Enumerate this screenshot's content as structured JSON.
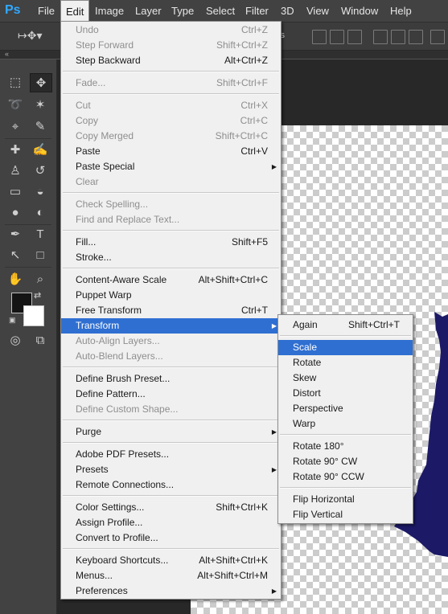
{
  "app": {
    "logo": "Ps"
  },
  "menubar": [
    "File",
    "Edit",
    "Image",
    "Layer",
    "Type",
    "Select",
    "Filter",
    "3D",
    "View",
    "Window",
    "Help"
  ],
  "options_bar": {
    "auto_label": "ols"
  },
  "toolbar": {
    "foreground_color": "#141414",
    "background_color": "#ffffff"
  },
  "edit_menu": {
    "items": [
      {
        "label": "Undo",
        "shortcut": "Ctrl+Z",
        "disabled": true
      },
      {
        "label": "Step Forward",
        "shortcut": "Shift+Ctrl+Z",
        "disabled": true
      },
      {
        "label": "Step Backward",
        "shortcut": "Alt+Ctrl+Z"
      },
      {
        "sep": true
      },
      {
        "label": "Fade...",
        "shortcut": "Shift+Ctrl+F",
        "disabled": true
      },
      {
        "sep": true
      },
      {
        "label": "Cut",
        "shortcut": "Ctrl+X",
        "disabled": true
      },
      {
        "label": "Copy",
        "shortcut": "Ctrl+C",
        "disabled": true
      },
      {
        "label": "Copy Merged",
        "shortcut": "Shift+Ctrl+C",
        "disabled": true
      },
      {
        "label": "Paste",
        "shortcut": "Ctrl+V"
      },
      {
        "label": "Paste Special",
        "submenu": true
      },
      {
        "label": "Clear",
        "disabled": true
      },
      {
        "sep": true
      },
      {
        "label": "Check Spelling...",
        "disabled": true
      },
      {
        "label": "Find and Replace Text...",
        "disabled": true
      },
      {
        "sep": true
      },
      {
        "label": "Fill...",
        "shortcut": "Shift+F5"
      },
      {
        "label": "Stroke..."
      },
      {
        "sep": true
      },
      {
        "label": "Content-Aware Scale",
        "shortcut": "Alt+Shift+Ctrl+C"
      },
      {
        "label": "Puppet Warp"
      },
      {
        "label": "Free Transform",
        "shortcut": "Ctrl+T"
      },
      {
        "label": "Transform",
        "submenu": true,
        "highlighted": true
      },
      {
        "label": "Auto-Align Layers...",
        "disabled": true
      },
      {
        "label": "Auto-Blend Layers...",
        "disabled": true
      },
      {
        "sep": true
      },
      {
        "label": "Define Brush Preset..."
      },
      {
        "label": "Define Pattern..."
      },
      {
        "label": "Define Custom Shape...",
        "disabled": true
      },
      {
        "sep": true
      },
      {
        "label": "Purge",
        "submenu": true
      },
      {
        "sep": true
      },
      {
        "label": "Adobe PDF Presets..."
      },
      {
        "label": "Presets",
        "submenu": true
      },
      {
        "label": "Remote Connections..."
      },
      {
        "sep": true
      },
      {
        "label": "Color Settings...",
        "shortcut": "Shift+Ctrl+K"
      },
      {
        "label": "Assign Profile..."
      },
      {
        "label": "Convert to Profile..."
      },
      {
        "sep": true
      },
      {
        "label": "Keyboard Shortcuts...",
        "shortcut": "Alt+Shift+Ctrl+K"
      },
      {
        "label": "Menus...",
        "shortcut": "Alt+Shift+Ctrl+M"
      },
      {
        "label": "Preferences",
        "submenu": true
      }
    ]
  },
  "transform_menu": {
    "items": [
      {
        "label": "Again",
        "shortcut": "Shift+Ctrl+T"
      },
      {
        "sep": true
      },
      {
        "label": "Scale",
        "highlighted": true
      },
      {
        "label": "Rotate"
      },
      {
        "label": "Skew"
      },
      {
        "label": "Distort"
      },
      {
        "label": "Perspective"
      },
      {
        "label": "Warp"
      },
      {
        "sep": true
      },
      {
        "label": "Rotate 180°"
      },
      {
        "label": "Rotate 90° CW"
      },
      {
        "label": "Rotate 90° CCW"
      },
      {
        "sep": true
      },
      {
        "label": "Flip Horizontal"
      },
      {
        "label": "Flip Vertical"
      }
    ]
  },
  "colors": {
    "menu_highlight": "#2f6fd1",
    "shape_fill": "#1c1a66"
  }
}
